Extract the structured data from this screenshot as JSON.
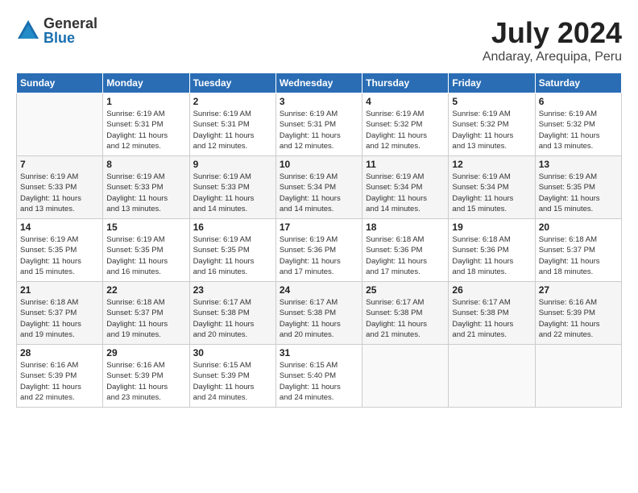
{
  "header": {
    "logo": {
      "general": "General",
      "blue": "Blue"
    },
    "title": "July 2024",
    "location": "Andaray, Arequipa, Peru"
  },
  "days_of_week": [
    "Sunday",
    "Monday",
    "Tuesday",
    "Wednesday",
    "Thursday",
    "Friday",
    "Saturday"
  ],
  "weeks": [
    [
      {
        "day": "",
        "info": ""
      },
      {
        "day": "1",
        "info": "Sunrise: 6:19 AM\nSunset: 5:31 PM\nDaylight: 11 hours\nand 12 minutes."
      },
      {
        "day": "2",
        "info": "Sunrise: 6:19 AM\nSunset: 5:31 PM\nDaylight: 11 hours\nand 12 minutes."
      },
      {
        "day": "3",
        "info": "Sunrise: 6:19 AM\nSunset: 5:31 PM\nDaylight: 11 hours\nand 12 minutes."
      },
      {
        "day": "4",
        "info": "Sunrise: 6:19 AM\nSunset: 5:32 PM\nDaylight: 11 hours\nand 12 minutes."
      },
      {
        "day": "5",
        "info": "Sunrise: 6:19 AM\nSunset: 5:32 PM\nDaylight: 11 hours\nand 13 minutes."
      },
      {
        "day": "6",
        "info": "Sunrise: 6:19 AM\nSunset: 5:32 PM\nDaylight: 11 hours\nand 13 minutes."
      }
    ],
    [
      {
        "day": "7",
        "info": "Sunrise: 6:19 AM\nSunset: 5:33 PM\nDaylight: 11 hours\nand 13 minutes."
      },
      {
        "day": "8",
        "info": "Sunrise: 6:19 AM\nSunset: 5:33 PM\nDaylight: 11 hours\nand 13 minutes."
      },
      {
        "day": "9",
        "info": "Sunrise: 6:19 AM\nSunset: 5:33 PM\nDaylight: 11 hours\nand 14 minutes."
      },
      {
        "day": "10",
        "info": "Sunrise: 6:19 AM\nSunset: 5:34 PM\nDaylight: 11 hours\nand 14 minutes."
      },
      {
        "day": "11",
        "info": "Sunrise: 6:19 AM\nSunset: 5:34 PM\nDaylight: 11 hours\nand 14 minutes."
      },
      {
        "day": "12",
        "info": "Sunrise: 6:19 AM\nSunset: 5:34 PM\nDaylight: 11 hours\nand 15 minutes."
      },
      {
        "day": "13",
        "info": "Sunrise: 6:19 AM\nSunset: 5:35 PM\nDaylight: 11 hours\nand 15 minutes."
      }
    ],
    [
      {
        "day": "14",
        "info": "Sunrise: 6:19 AM\nSunset: 5:35 PM\nDaylight: 11 hours\nand 15 minutes."
      },
      {
        "day": "15",
        "info": "Sunrise: 6:19 AM\nSunset: 5:35 PM\nDaylight: 11 hours\nand 16 minutes."
      },
      {
        "day": "16",
        "info": "Sunrise: 6:19 AM\nSunset: 5:35 PM\nDaylight: 11 hours\nand 16 minutes."
      },
      {
        "day": "17",
        "info": "Sunrise: 6:19 AM\nSunset: 5:36 PM\nDaylight: 11 hours\nand 17 minutes."
      },
      {
        "day": "18",
        "info": "Sunrise: 6:18 AM\nSunset: 5:36 PM\nDaylight: 11 hours\nand 17 minutes."
      },
      {
        "day": "19",
        "info": "Sunrise: 6:18 AM\nSunset: 5:36 PM\nDaylight: 11 hours\nand 18 minutes."
      },
      {
        "day": "20",
        "info": "Sunrise: 6:18 AM\nSunset: 5:37 PM\nDaylight: 11 hours\nand 18 minutes."
      }
    ],
    [
      {
        "day": "21",
        "info": "Sunrise: 6:18 AM\nSunset: 5:37 PM\nDaylight: 11 hours\nand 19 minutes."
      },
      {
        "day": "22",
        "info": "Sunrise: 6:18 AM\nSunset: 5:37 PM\nDaylight: 11 hours\nand 19 minutes."
      },
      {
        "day": "23",
        "info": "Sunrise: 6:17 AM\nSunset: 5:38 PM\nDaylight: 11 hours\nand 20 minutes."
      },
      {
        "day": "24",
        "info": "Sunrise: 6:17 AM\nSunset: 5:38 PM\nDaylight: 11 hours\nand 20 minutes."
      },
      {
        "day": "25",
        "info": "Sunrise: 6:17 AM\nSunset: 5:38 PM\nDaylight: 11 hours\nand 21 minutes."
      },
      {
        "day": "26",
        "info": "Sunrise: 6:17 AM\nSunset: 5:38 PM\nDaylight: 11 hours\nand 21 minutes."
      },
      {
        "day": "27",
        "info": "Sunrise: 6:16 AM\nSunset: 5:39 PM\nDaylight: 11 hours\nand 22 minutes."
      }
    ],
    [
      {
        "day": "28",
        "info": "Sunrise: 6:16 AM\nSunset: 5:39 PM\nDaylight: 11 hours\nand 22 minutes."
      },
      {
        "day": "29",
        "info": "Sunrise: 6:16 AM\nSunset: 5:39 PM\nDaylight: 11 hours\nand 23 minutes."
      },
      {
        "day": "30",
        "info": "Sunrise: 6:15 AM\nSunset: 5:39 PM\nDaylight: 11 hours\nand 24 minutes."
      },
      {
        "day": "31",
        "info": "Sunrise: 6:15 AM\nSunset: 5:40 PM\nDaylight: 11 hours\nand 24 minutes."
      },
      {
        "day": "",
        "info": ""
      },
      {
        "day": "",
        "info": ""
      },
      {
        "day": "",
        "info": ""
      }
    ]
  ]
}
